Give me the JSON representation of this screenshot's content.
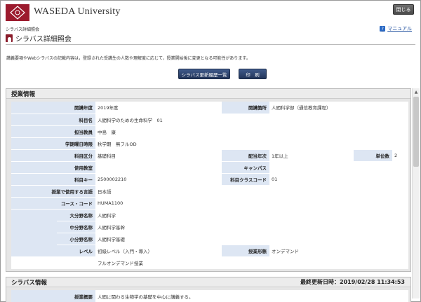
{
  "header": {
    "logo_text": "WASEDA University",
    "close_label": "閉じる"
  },
  "subheader": {
    "crumb": "シラバス詳細照会",
    "manual_label": "マニュアル",
    "help_glyph": "?"
  },
  "page": {
    "title": "シラバス詳細照会"
  },
  "notice": "講義要項やWebシラバスの記載内容は，登録された受講生の人数や理解度に応じて，授業開始後に変更となる可能性があります。",
  "buttons": {
    "history": "シラバス更新履歴一覧",
    "print": "印　刷"
  },
  "course_info": {
    "heading": "授業情報",
    "rows": {
      "year_label": "開講年度",
      "year_value": "2019年度",
      "school_label": "開講箇所",
      "school_value": "人間科学部（通信教育課程）",
      "subject_label": "科目名",
      "subject_value": "人間科学のための生命科学　01",
      "teacher_label": "担当教員",
      "teacher_value": "中島　康",
      "term_label": "学期曜日時限",
      "term_value": "秋学期　無フルOD",
      "category_label": "科目区分",
      "category_value": "基礎科目",
      "grade_label": "配当年次",
      "grade_value": "1年以上",
      "credit_label": "単位数",
      "credit_value": "2",
      "room_label": "使用教室",
      "room_value": "",
      "campus_label": "キャンパス",
      "campus_value": "",
      "key_label": "科目キー",
      "key_value": "2500002210",
      "class_label": "科目クラスコード",
      "class_value": "01",
      "lang_label": "授業で使用する言語",
      "lang_value": "日本語",
      "code_label": "コース・コード",
      "code_value": "HUMA1100",
      "major_label": "大分野名称",
      "major_value": "人間科学",
      "mid_label": "中分野名称",
      "mid_value": "人間科学基幹",
      "minor_label": "小分野名称",
      "minor_value": "人間科学基礎",
      "level_label": "レベル",
      "level_value": "初級レベル（入門・導入）",
      "form_label": "授業形態",
      "form_value": "オンデマンド",
      "form_note": "フルオンデマンド授業"
    }
  },
  "syllabus_info": {
    "heading": "シラバス情報",
    "updated": "最終更新日時：2019/02/28 11:34:53",
    "summary_label": "授業概要",
    "summary_value": "人間に関わる生物学の基礎を中心に講義する。"
  }
}
